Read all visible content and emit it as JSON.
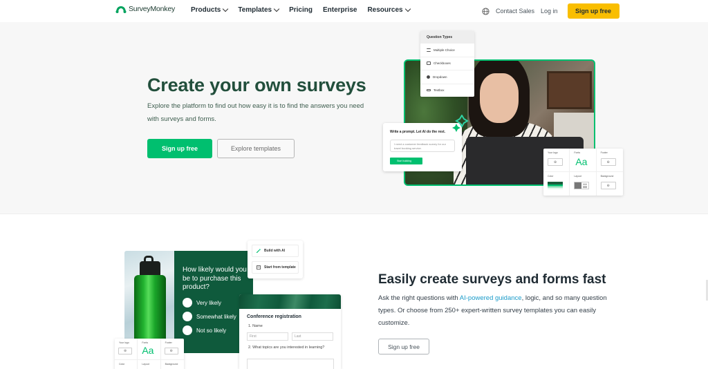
{
  "nav": {
    "logo_text": "SurveyMonkey",
    "links": [
      {
        "label": "Products",
        "dropdown": true
      },
      {
        "label": "Templates",
        "dropdown": true
      },
      {
        "label": "Pricing",
        "dropdown": false
      },
      {
        "label": "Enterprise",
        "dropdown": false
      },
      {
        "label": "Resources",
        "dropdown": true
      }
    ],
    "globe_icon": "globe-icon",
    "contact_sales": "Contact Sales",
    "login": "Log in",
    "signup": "Sign up free"
  },
  "hero": {
    "title": "Create your own surveys",
    "description": "Explore the platform to find out how easy it is to find the answers you need with surveys and forms.",
    "primary_button": "Sign up free",
    "secondary_button": "Explore templates",
    "question_types": {
      "title": "Question Types",
      "items": [
        "Multiple Choice",
        "Checkboxes",
        "Dropdown",
        "Textbox"
      ]
    },
    "ai_card": {
      "title": "Write a prompt. Let AI do the rest.",
      "prompt": "I need a customer feedback survey for our travel booking service.",
      "button": "Start building"
    },
    "theme_card": {
      "your_logo": "Your logo",
      "fonts": "Fonts",
      "fonts_sample": "Aa",
      "footer": "Footer",
      "color": "Color",
      "layout": "Layout",
      "background": "Background"
    }
  },
  "section2": {
    "title": "Easily create surveys and forms fast",
    "desc_before": "Ask the right questions with ",
    "desc_link": "AI-powered guidance",
    "desc_after": ", logic, and so many question types. Or choose from 250+ expert-written survey templates you can easily customize.",
    "button": "Sign up free",
    "question_card": {
      "question": "How likely would you be to purchase this product?",
      "options": [
        "Very likely",
        "Somewhat likely",
        "Not so likely"
      ]
    },
    "build_card": {
      "build_ai": "Build with AI",
      "start_template": "Start from template"
    },
    "conference_card": {
      "title": "Conference registration",
      "q1": "1. Name",
      "first_placeholder": "First",
      "last_placeholder": "Last",
      "q2": "2. What topics are you interested in learning?"
    },
    "theme_card": {
      "your_logo": "Your logo",
      "fonts": "Fonts",
      "fonts_sample": "Aa",
      "footer": "Footer",
      "color": "Color",
      "layout": "Layout",
      "background": "Background"
    }
  },
  "colors": {
    "brand_green": "#00bf6f",
    "dark_green": "#224f3c",
    "signup_yellow": "#f9be00",
    "link_blue": "#1a9bc9"
  }
}
